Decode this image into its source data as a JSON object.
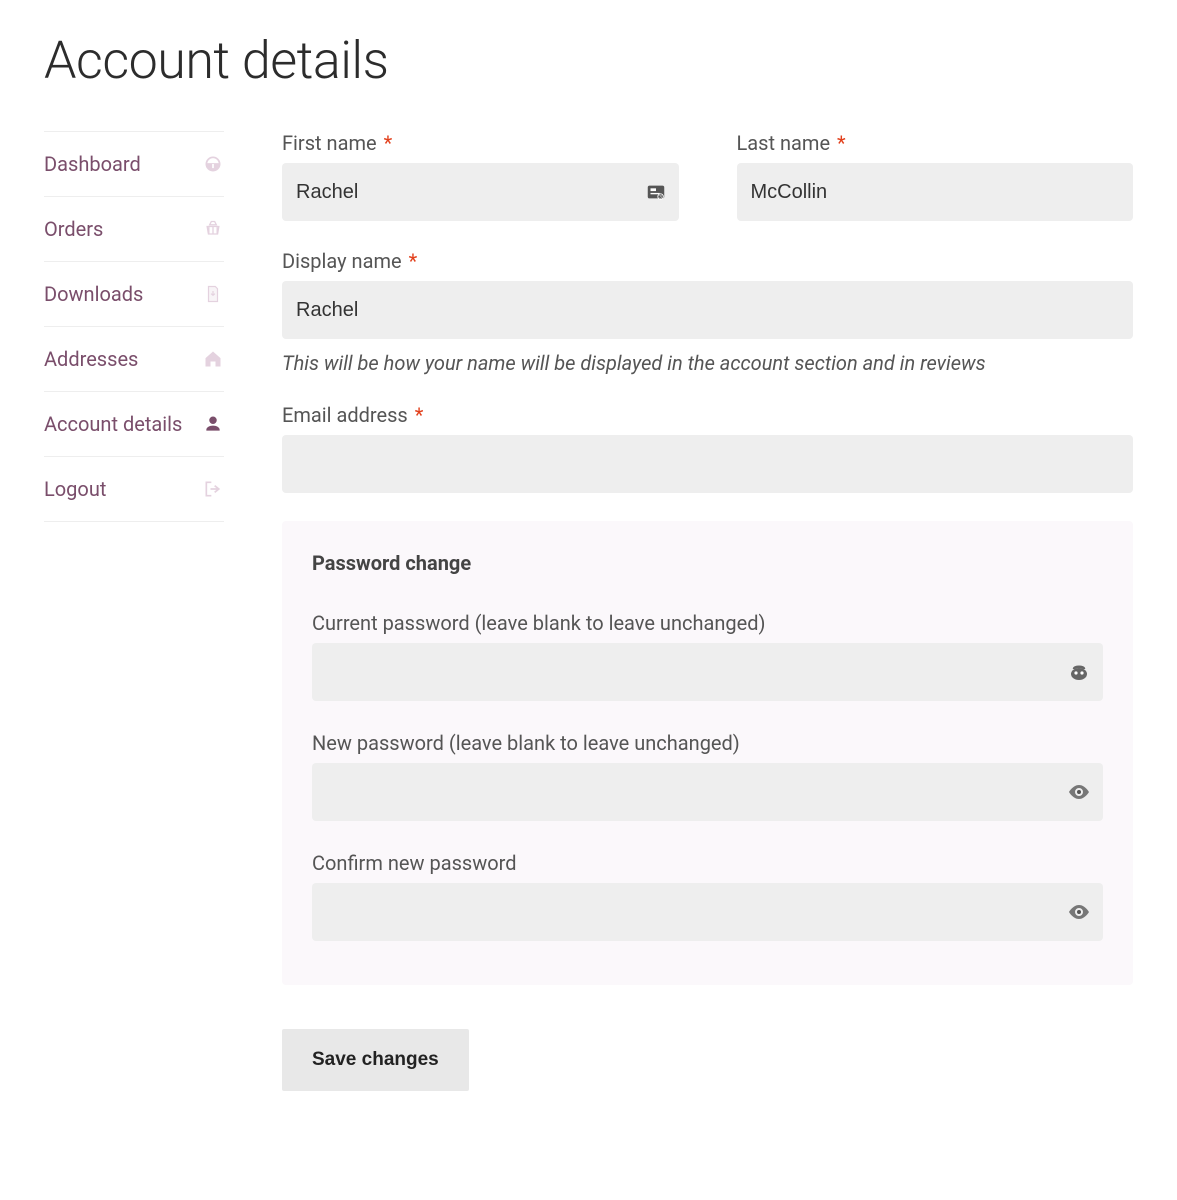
{
  "page_title": "Account details",
  "required_marker": "*",
  "sidebar": {
    "items": [
      {
        "label": "Dashboard",
        "icon": "dashboard-icon",
        "active": false
      },
      {
        "label": "Orders",
        "icon": "basket-icon",
        "active": false
      },
      {
        "label": "Downloads",
        "icon": "download-icon",
        "active": false
      },
      {
        "label": "Addresses",
        "icon": "home-icon",
        "active": false
      },
      {
        "label": "Account details",
        "icon": "user-icon",
        "active": true
      },
      {
        "label": "Logout",
        "icon": "logout-icon",
        "active": false
      }
    ]
  },
  "form": {
    "first_name": {
      "label": "First name",
      "value": "Rachel",
      "required": true
    },
    "last_name": {
      "label": "Last name",
      "value": "McCollin",
      "required": true
    },
    "display_name": {
      "label": "Display name",
      "value": "Rachel",
      "required": true,
      "help": "This will be how your name will be displayed in the account section and in reviews"
    },
    "email": {
      "label": "Email address",
      "value": "",
      "required": true
    },
    "password_panel": {
      "legend": "Password change",
      "current": {
        "label": "Current password (leave blank to leave unchanged)",
        "value": ""
      },
      "new": {
        "label": "New password (leave blank to leave unchanged)",
        "value": ""
      },
      "confirm": {
        "label": "Confirm new password",
        "value": ""
      }
    },
    "save_label": "Save changes"
  }
}
